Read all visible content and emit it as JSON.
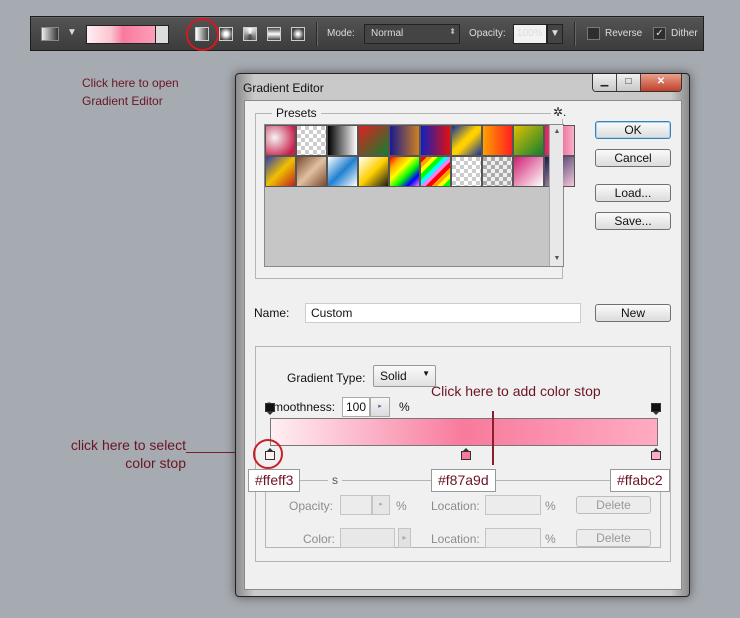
{
  "options_bar": {
    "mode_label": "Mode:",
    "mode_value": "Normal",
    "opacity_label": "Opacity:",
    "opacity_value": "100%",
    "reverse_label": "Reverse",
    "reverse_checked": false,
    "dither_label": "Dither",
    "dither_checked": true,
    "check_mark": "✓",
    "dropdown_arrow": "▼",
    "mode_arrows": "⬍"
  },
  "annotations": {
    "open_editor": "Click here to open\nGradient Editor",
    "open_editor_line1": "Click here to open",
    "open_editor_line2": "Gradient Editor",
    "add_stop": "Click here to add color stop",
    "select_stop_line1": "click here to select",
    "select_stop_line2": "color stop",
    "accent_color": "#6b1523",
    "ring_color": "#d8181e"
  },
  "dialog": {
    "title": "Gradient Editor",
    "window_buttons": {
      "minimize": "▁",
      "maximize": "□",
      "close": "✕"
    },
    "presets": {
      "label": "Presets",
      "gear": "✲.",
      "scroll_up": "▲",
      "scroll_down": "▼",
      "swatches": [
        "radial-gradient(circle at 30% 40%, #f4f4f4, #c8204c 80%)",
        "repeating-conic-gradient(#fff 0 25%, #ccc 0 50%) 0 0/8px 8px",
        "linear-gradient(90deg, #000, #fff)",
        "linear-gradient(135deg, #e02020, #108030)",
        "linear-gradient(90deg, #1a1a90, #d08020)",
        "linear-gradient(90deg, #1020c0, #e01010)",
        "linear-gradient(135deg, #1030a0, #ffd000 45%, #ffd000 55%, #1030a0)",
        "linear-gradient(90deg, #ffa000, #ff2020)",
        "linear-gradient(135deg, #e0c000, #108030)",
        "linear-gradient(90deg, #e02060, #f8b0c8)",
        "linear-gradient(135deg, #3040b0, #f0c000, #c02020)",
        "linear-gradient(135deg, #7a4a30, #e0c0a0, #7a4a30)",
        "linear-gradient(135deg, #fff, #2080d0, #fff)",
        "linear-gradient(135deg, #fff, #ffd000, #1a1a1a)",
        "linear-gradient(135deg, red, orange, yellow, lime, blue, violet)",
        "repeating-linear-gradient(135deg, red 0 4px, orange 4px 8px, yellow 8px 12px, lime 12px 16px, cyan 16px 20px, violet 20px 24px)",
        "repeating-conic-gradient(#fff 0 25%, #ccc 0 50%) 0 0/8px 8px",
        "repeating-conic-gradient(#eee 0 25%, #aaa 0 50%) 0 0/8px 8px",
        "linear-gradient(135deg, #d02070, #fff)",
        "linear-gradient(135deg, #1a1a50, #f8c8d8)"
      ]
    },
    "buttons": {
      "ok": "OK",
      "cancel": "Cancel",
      "load": "Load...",
      "save": "Save...",
      "new": "New"
    },
    "name_label": "Name:",
    "name_value": "Custom",
    "gradient_type_label": "Gradient Type:",
    "gradient_type_value": "Solid",
    "smoothness_label": "Smoothness:",
    "smoothness_value": "100",
    "smoothness_unit": "%",
    "spin_arrow": "▸",
    "color_stops": [
      {
        "color": "#ffeff3",
        "label": "#ffeff3",
        "location_pct": 0
      },
      {
        "color": "#f87a9d",
        "label": "#f87a9d",
        "location_pct": 50
      },
      {
        "color": "#ffabc2",
        "label": "#ffabc2",
        "location_pct": 100
      }
    ],
    "stops_group": {
      "label_fragment": "s",
      "opacity_label": "Opacity:",
      "color_label": "Color:",
      "location_label": "Location:",
      "pct": "%",
      "delete_label": "Delete"
    }
  }
}
